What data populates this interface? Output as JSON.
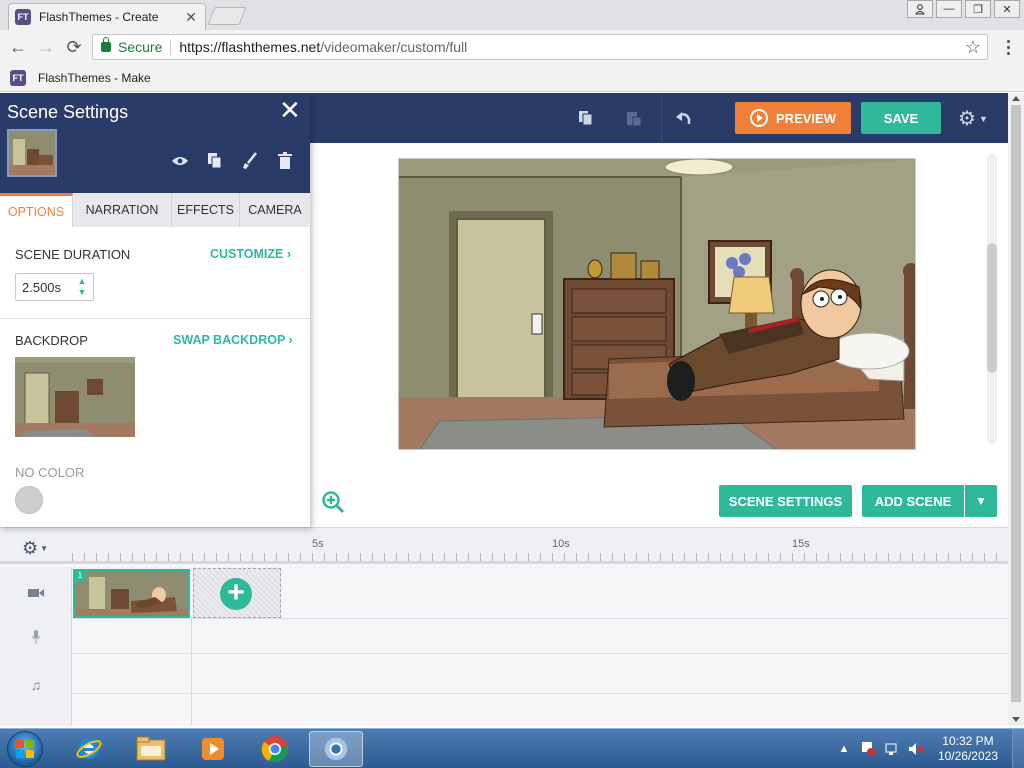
{
  "browser": {
    "tab_title": "FlashThemes - Create",
    "favicon_text": "FT",
    "secure_label": "Secure",
    "url_host": "https://flashthemes.net",
    "url_path": "/videomaker/custom/full",
    "bookmark_title": "FlashThemes - Make"
  },
  "toolbar": {
    "preview_label": "PREVIEW",
    "save_label": "SAVE"
  },
  "panel": {
    "title": "Scene Settings",
    "tabs": [
      "OPTIONS",
      "NARRATION",
      "EFFECTS",
      "CAMERA"
    ],
    "active_tab": "OPTIONS",
    "scene_duration_label": "SCENE DURATION",
    "customize_label": "CUSTOMIZE ›",
    "duration_value": "2.500s",
    "backdrop_label": "BACKDROP",
    "swap_backdrop_label": "SWAP BACKDROP ›",
    "no_color_label": "NO COLOR"
  },
  "scene_actions": {
    "scene_settings_label": "SCENE SETTINGS",
    "add_scene_label": "ADD SCENE"
  },
  "timeline": {
    "tick_labels": [
      "5s",
      "10s",
      "15s"
    ],
    "scene_number": "1"
  },
  "taskbar": {
    "time": "10:32 PM",
    "date": "10/26/2023"
  },
  "colors": {
    "topbar": "#293b68",
    "accent_green": "#30b89a",
    "accent_orange": "#f07f3a"
  }
}
